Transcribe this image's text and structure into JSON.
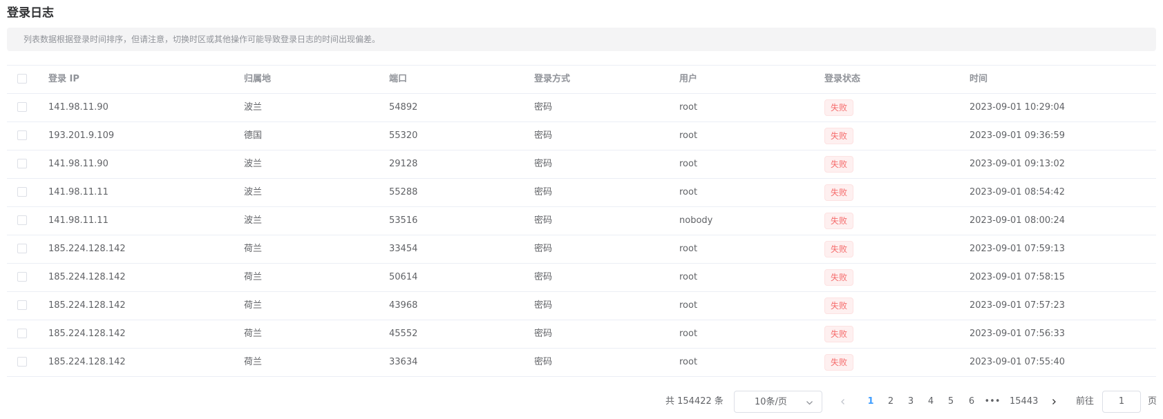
{
  "title": "登录日志",
  "notice": "列表数据根据登录时间排序，但请注意，切换时区或其他操作可能导致登录日志的时间出现偏差。",
  "columns": {
    "ip": "登录 IP",
    "location": "归属地",
    "port": "端口",
    "method": "登录方式",
    "user": "用户",
    "status": "登录状态",
    "time": "时间"
  },
  "rows": [
    {
      "ip": "141.98.11.90",
      "location": "波兰",
      "port": "54892",
      "method": "密码",
      "user": "root",
      "status": "失败",
      "time": "2023-09-01 10:29:04"
    },
    {
      "ip": "193.201.9.109",
      "location": "德国",
      "port": "55320",
      "method": "密码",
      "user": "root",
      "status": "失败",
      "time": "2023-09-01 09:36:59"
    },
    {
      "ip": "141.98.11.90",
      "location": "波兰",
      "port": "29128",
      "method": "密码",
      "user": "root",
      "status": "失败",
      "time": "2023-09-01 09:13:02"
    },
    {
      "ip": "141.98.11.11",
      "location": "波兰",
      "port": "55288",
      "method": "密码",
      "user": "root",
      "status": "失败",
      "time": "2023-09-01 08:54:42"
    },
    {
      "ip": "141.98.11.11",
      "location": "波兰",
      "port": "53516",
      "method": "密码",
      "user": "nobody",
      "status": "失败",
      "time": "2023-09-01 08:00:24"
    },
    {
      "ip": "185.224.128.142",
      "location": "荷兰",
      "port": "33454",
      "method": "密码",
      "user": "root",
      "status": "失败",
      "time": "2023-09-01 07:59:13"
    },
    {
      "ip": "185.224.128.142",
      "location": "荷兰",
      "port": "50614",
      "method": "密码",
      "user": "root",
      "status": "失败",
      "time": "2023-09-01 07:58:15"
    },
    {
      "ip": "185.224.128.142",
      "location": "荷兰",
      "port": "43968",
      "method": "密码",
      "user": "root",
      "status": "失败",
      "time": "2023-09-01 07:57:23"
    },
    {
      "ip": "185.224.128.142",
      "location": "荷兰",
      "port": "45552",
      "method": "密码",
      "user": "root",
      "status": "失败",
      "time": "2023-09-01 07:56:33"
    },
    {
      "ip": "185.224.128.142",
      "location": "荷兰",
      "port": "33634",
      "method": "密码",
      "user": "root",
      "status": "失败",
      "time": "2023-09-01 07:55:40"
    }
  ],
  "pagination": {
    "total_label": "共 154422 条",
    "page_size": "10条/页",
    "pages": [
      "1",
      "2",
      "3",
      "4",
      "5",
      "6",
      "•••",
      "15443"
    ],
    "current_page": "1",
    "goto_label": "前往",
    "goto_value": "1",
    "page_suffix": "页"
  },
  "colors": {
    "status_fail": "#f56c6c",
    "active_page": "#409eff"
  }
}
